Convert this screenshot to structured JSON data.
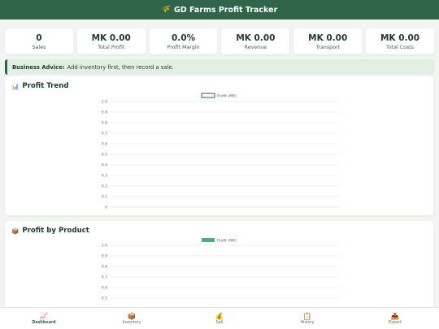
{
  "app": {
    "title": "GD Farms Profit Tracker",
    "logo_icon": "🌾"
  },
  "stats": [
    {
      "value": "0",
      "label": "Sales"
    },
    {
      "value": "MK 0.00",
      "label": "Total Profit"
    },
    {
      "value": "0.0%",
      "label": "Profit Margin"
    },
    {
      "value": "MK 0.00",
      "label": "Revenue"
    },
    {
      "value": "MK 0.00",
      "label": "Transport"
    },
    {
      "value": "MK 0.00",
      "label": "Total Costs"
    }
  ],
  "advice": {
    "label": "Business Advice:",
    "text": "Add inventory first, then record a sale."
  },
  "profit_trend": {
    "icon": "📊",
    "title": "Profit Trend",
    "legend": "Profit (MK)",
    "y_ticks": [
      "1.0",
      "0.9",
      "0.8",
      "0.7",
      "0.6",
      "0.5",
      "0.4",
      "0.3",
      "0.2",
      "0.1",
      "0"
    ]
  },
  "profit_by_product": {
    "icon": "📦",
    "title": "Profit by Product",
    "legend": "Profit (MK)",
    "y_ticks": [
      "1.0",
      "0.9",
      "0.8",
      "0.7",
      "0.6",
      "0.5"
    ]
  },
  "nav": [
    {
      "icon": "📈",
      "label": "Dashboard",
      "active": true
    },
    {
      "icon": "📦",
      "label": "Inventory",
      "active": false
    },
    {
      "icon": "💰",
      "label": "Sell",
      "active": false
    },
    {
      "icon": "📋",
      "label": "History",
      "active": false
    },
    {
      "icon": "📤",
      "label": "Export",
      "active": false
    }
  ],
  "chart_data": [
    {
      "type": "line",
      "title": "Profit Trend",
      "series": [
        {
          "name": "Profit (MK)",
          "values": []
        }
      ],
      "ylim": [
        0,
        1.0
      ],
      "legend_position": "top",
      "grid": true
    },
    {
      "type": "bar",
      "title": "Profit by Product",
      "series": [
        {
          "name": "Profit (MK)",
          "values": []
        }
      ],
      "ylim": [
        0,
        1.0
      ],
      "legend_position": "top",
      "grid": true
    }
  ],
  "colors": {
    "brand": "#2e6448",
    "line_legend": "#2e6448",
    "bar_legend": "#4caf7d",
    "grid": "#e6e6e6",
    "background": "#f1f4f1"
  }
}
